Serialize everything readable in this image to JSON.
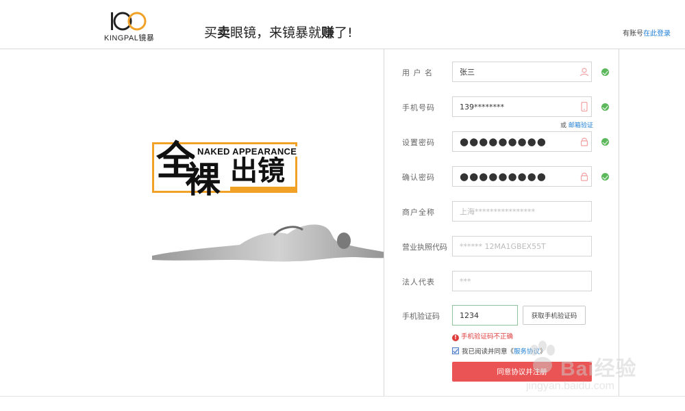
{
  "header": {
    "logo_text": "KINGPAL",
    "logo_cn": "镜暴",
    "slogan_a": "买",
    "slogan_b": "卖",
    "slogan_c": "眼镜，来镜暴就",
    "slogan_d": "赚",
    "slogan_e": "了!",
    "login_prefix": "有账号",
    "login_link": "在此登录"
  },
  "banner": {
    "title_en": "NAKED APPEARANCE",
    "title_cn_1": "全",
    "title_cn_2": "裸",
    "title_cn_3": "出镜"
  },
  "form": {
    "username": {
      "label": "用 户 名",
      "value": "张三",
      "icon": "user-icon"
    },
    "phone": {
      "label": "手机号码",
      "value": "139********",
      "icon": "phone-icon"
    },
    "email_alt_prefix": "或",
    "email_alt_link": "邮箱验证",
    "password": {
      "label": "设置密码",
      "value": "●●●●●●●●●",
      "icon": "lock-icon"
    },
    "confirm": {
      "label": "确认密码",
      "value": "●●●●●●●●●",
      "icon": "lock-icon"
    },
    "merchant": {
      "label": "商户全称",
      "value": "上海****************"
    },
    "license": {
      "label": "营业执照代码",
      "value": "****** 12MA1GBEX55T"
    },
    "legal": {
      "label": "法人代表",
      "value": "***"
    },
    "sms": {
      "label": "手机验证码",
      "value": "1234",
      "button": "获取手机验证码"
    },
    "error": "手机验证码不正确",
    "agree_prefix": "我已阅读并同意《",
    "agree_link": "服务协议",
    "agree_suffix": "》",
    "submit": "同意协议并注册"
  },
  "watermark": {
    "brand": "Bai经验",
    "url": "jingyan.baidu.com"
  },
  "colors": {
    "accent_orange": "#f0a126",
    "submit_red": "#ea5454",
    "link_blue": "#1e7fd6",
    "ok_green": "#5bb85b",
    "error_red": "#e03c3c"
  }
}
